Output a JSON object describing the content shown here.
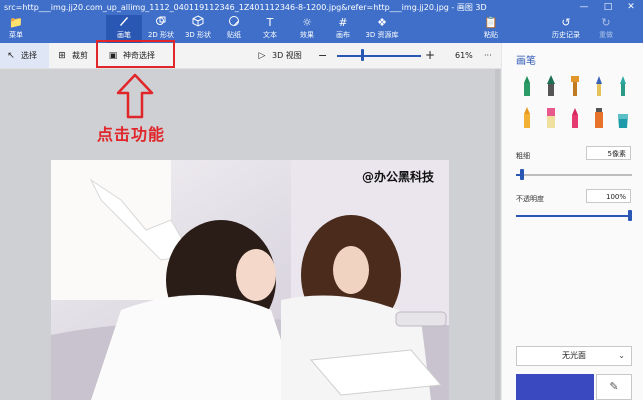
{
  "window": {
    "title": "src=http___img.jj20.com_up_allimg_1112_040119112346_1Z401112346-8-1200.jpg&refer=http___img.jj20.jpg - 画图 3D",
    "minimize_icon": "minimize-icon",
    "maximize_icon": "maximize-icon",
    "close_icon": "close-icon"
  },
  "ribbon": {
    "menu": "菜单",
    "items": [
      {
        "label": "画笔",
        "icon": "brush-icon"
      },
      {
        "label": "2D 形状",
        "icon": "shapes-2d-icon"
      },
      {
        "label": "3D 形状",
        "icon": "cube-icon"
      },
      {
        "label": "贴纸",
        "icon": "sticker-icon"
      },
      {
        "label": "文本",
        "icon": "text-icon"
      },
      {
        "label": "效果",
        "icon": "sun-icon"
      },
      {
        "label": "画布",
        "icon": "canvas-icon"
      },
      {
        "label": "3D 资源库",
        "icon": "library-icon"
      }
    ],
    "right": [
      {
        "label": "粘贴",
        "icon": "paste-icon"
      },
      {
        "label": "历史记录",
        "icon": "history-icon"
      },
      {
        "label": "重做",
        "icon": "redo-icon"
      }
    ]
  },
  "toolbar": {
    "select": "选择",
    "crop": "裁剪",
    "magic_select": "神奇选择",
    "view3d": "3D 视图",
    "zoom_out": "−",
    "zoom_in": "+",
    "zoom_level": "61%",
    "more": "···",
    "zoom_value_fraction": 0.28
  },
  "annotation": {
    "text": "点击功能",
    "color": "#e0262a"
  },
  "canvas": {
    "watermark": "@办公黑科技"
  },
  "panel": {
    "title": "画笔",
    "thickness_label": "粗细",
    "thickness_value": "5像素",
    "thickness_fraction": 0.05,
    "opacity_label": "不透明度",
    "opacity_value": "100%",
    "opacity_fraction": 1.0,
    "finish": "无光面",
    "current_color": "#3a49c0",
    "eyedropper_icon": "eyedropper-icon"
  },
  "colors": {
    "ribbon": "#3f6fc9",
    "accent": "#2b57b4"
  }
}
